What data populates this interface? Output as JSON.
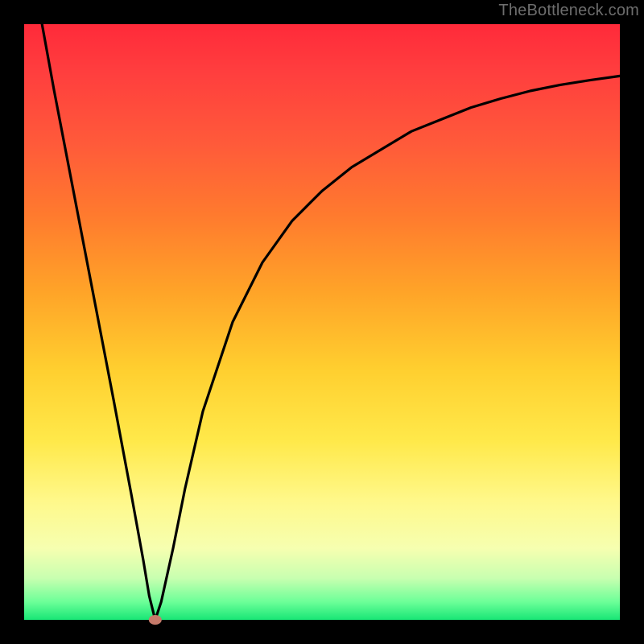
{
  "watermark": {
    "text": "TheBottleneck.com"
  },
  "chart_data": {
    "type": "line",
    "title": "",
    "xlabel": "",
    "ylabel": "",
    "xlim": [
      0,
      100
    ],
    "ylim": [
      0,
      100
    ],
    "background_gradient_legend": {
      "top_color_meaning": "high / bad (red)",
      "bottom_color_meaning": "low / good (green)"
    },
    "series": [
      {
        "name": "bottleneck-curve",
        "comment": "V-shaped curve dipping to y≈0 near x≈22, rising sharply to left and asymptotically toward right",
        "x": [
          3,
          5,
          10,
          15,
          18,
          20,
          21,
          22,
          23,
          25,
          27,
          30,
          35,
          40,
          45,
          50,
          55,
          60,
          65,
          70,
          75,
          80,
          85,
          90,
          95,
          100
        ],
        "y": [
          100,
          89,
          63,
          37,
          21,
          10,
          4,
          0,
          3,
          12,
          22,
          35,
          50,
          60,
          67,
          72,
          76,
          79,
          82,
          84,
          86,
          87.5,
          88.8,
          89.8,
          90.6,
          91.3
        ]
      }
    ],
    "marker": {
      "name": "optimal-point",
      "x": 22,
      "y": 0,
      "color": "#c67a6a",
      "radius_px": 8
    },
    "grid": false,
    "legend": false
  }
}
